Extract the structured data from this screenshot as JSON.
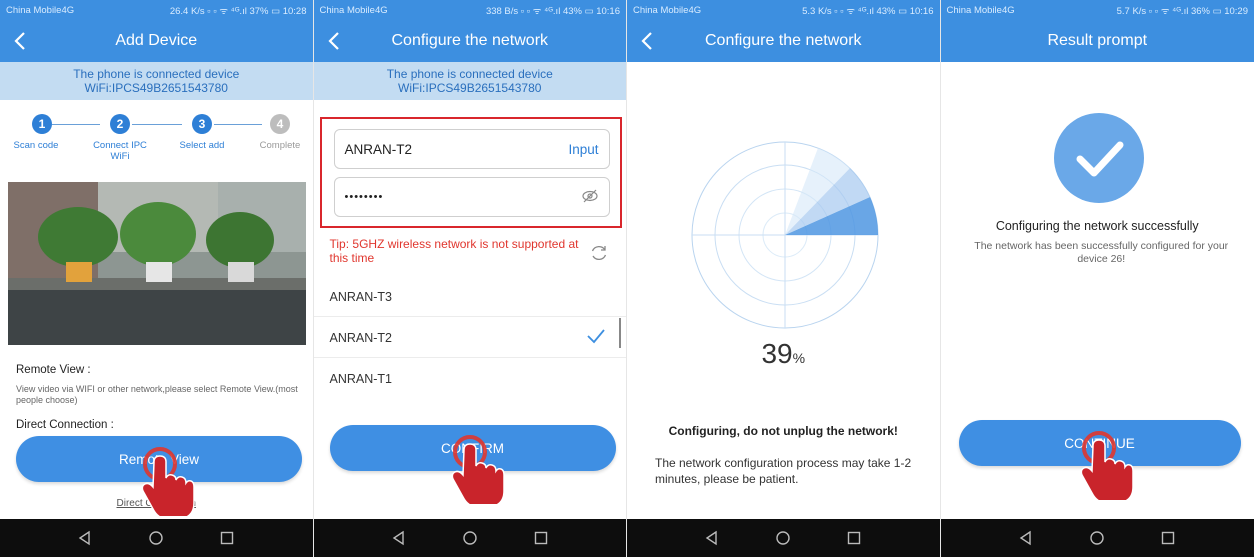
{
  "colors": {
    "accent": "#3d8fe0",
    "banner_bg": "#c3dcf2",
    "error": "#e0362e",
    "highlight_border": "#d9262c",
    "nav_bg": "#0d0d0d"
  },
  "screens": [
    {
      "status": {
        "carrier": "China Mobile4G",
        "right": "26.4 K/s ▫ ▫ ᯤ ⁴ᴳ.ıl 37% ▭ 10:28"
      },
      "title": "Add Device",
      "banner": {
        "line1": "The phone is connected device",
        "line2": "WiFi:IPCS49B2651543780"
      },
      "steps": [
        {
          "num": "1",
          "label": "Scan code",
          "active": true
        },
        {
          "num": "2",
          "label": "Connect IPC",
          "label2": "WiFi",
          "active": true
        },
        {
          "num": "3",
          "label": "Select add",
          "active": true
        },
        {
          "num": "4",
          "label": "Complete",
          "active": false
        }
      ],
      "remote_view_title": "Remote View :",
      "remote_view_desc": "View video via WIFI or other network,please select Remote View.(most people choose)",
      "direct_title": "Direct Connection :",
      "button_label": "Remote View",
      "link_label": "Direct Connection"
    },
    {
      "status": {
        "carrier": "China Mobile4G",
        "right": "338 B/s ▫ ▫ ᯤ ⁴ᴳ.ıl 43% ▭ 10:16"
      },
      "title": "Configure the network",
      "banner": {
        "line1": "The phone is connected device",
        "line2": "WiFi:IPCS49B2651543780"
      },
      "ssid_value": "ANRAN-T2",
      "ssid_action": "Input",
      "password_masked": "••••••••",
      "tip": "Tip: 5GHZ wireless network is not supported at this time",
      "networks": [
        {
          "name": "ANRAN-T3",
          "selected": false
        },
        {
          "name": "ANRAN-T2",
          "selected": true
        },
        {
          "name": "ANRAN-T1",
          "selected": false
        }
      ],
      "button_label": "CONFIRM"
    },
    {
      "status": {
        "carrier": "China Mobile4G",
        "right": "5.3 K/s ▫ ▫ ᯤ ⁴ᴳ.ıl 43% ▭ 10:16"
      },
      "title": "Configure the network",
      "progress": 39,
      "progress_value": "39",
      "progress_unit": "%",
      "bold_text": "Configuring, do not unplug the network!",
      "desc": "The network configuration process may take 1-2 minutes, please be patient."
    },
    {
      "status": {
        "carrier": "China Mobile4G",
        "right": "5.7 K/s ▫ ▫ ᯤ ⁴ᴳ.ıl 36% ▭ 10:29"
      },
      "title": "Result prompt",
      "result_title": "Configuring the network successfully",
      "result_desc": "The network has been successfully configured for your device 26!",
      "button_label": "CONTINUE"
    }
  ]
}
